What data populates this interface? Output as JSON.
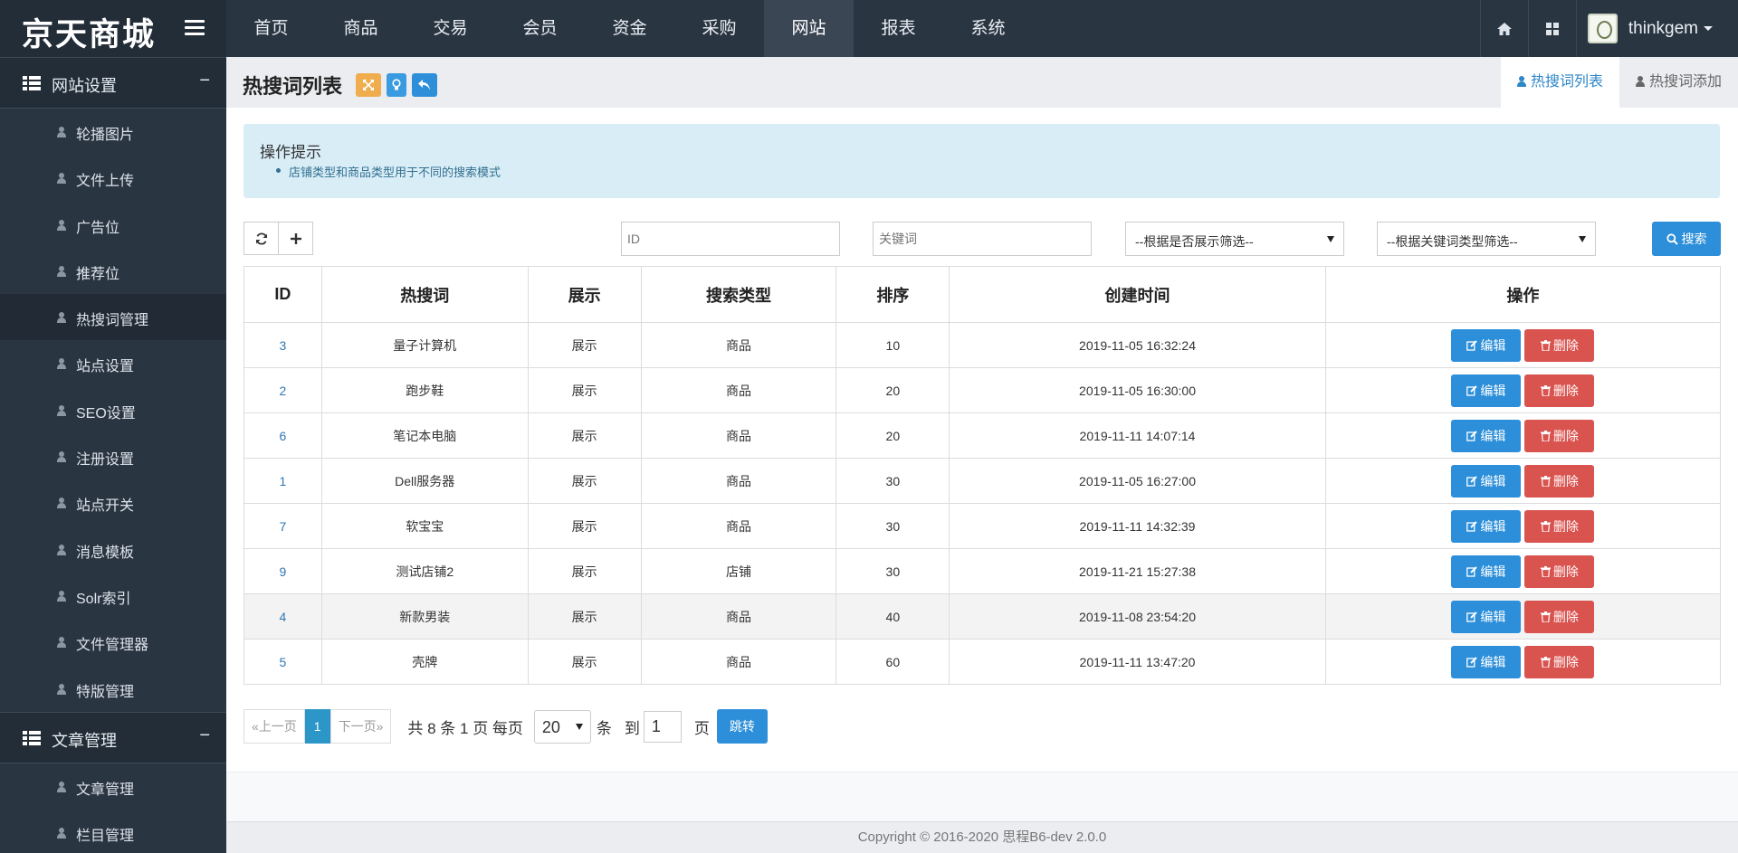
{
  "brand": {
    "logo": "京天商城"
  },
  "topnav": [
    "首页",
    "商品",
    "交易",
    "会员",
    "资金",
    "采购",
    "网站",
    "报表",
    "系统"
  ],
  "topnav_active": "网站",
  "user": {
    "name": "thinkgem"
  },
  "sidebar": {
    "sections": [
      {
        "title": "网站设置",
        "toggle": "−",
        "items": [
          "轮播图片",
          "文件上传",
          "广告位",
          "推荐位",
          "热搜词管理",
          "站点设置",
          "SEO设置",
          "注册设置",
          "站点开关",
          "消息模板",
          "Solr索引",
          "文件管理器",
          "特版管理"
        ]
      },
      {
        "title": "文章管理",
        "toggle": "−",
        "items": [
          "文章管理",
          "栏目管理"
        ]
      }
    ],
    "active_item": "热搜词管理"
  },
  "page": {
    "title": "热搜词列表",
    "tabs": [
      "热搜词列表",
      "热搜词添加"
    ],
    "tip_title": "操作提示",
    "tip_text": "店铺类型和商品类型用于不同的搜索模式"
  },
  "filters": {
    "id_placeholder": "ID",
    "keyword_placeholder": "关键词",
    "show_select": "--根据是否展示筛选--",
    "type_select": "--根据关键词类型筛选--",
    "search_label": "搜索"
  },
  "table": {
    "headers": [
      "ID",
      "热搜词",
      "展示",
      "搜索类型",
      "排序",
      "创建时间",
      "操作"
    ],
    "rows": [
      [
        "3",
        "量子计算机",
        "展示",
        "商品",
        "10",
        "2019-11-05 16:32:24"
      ],
      [
        "2",
        "跑步鞋",
        "展示",
        "商品",
        "20",
        "2019-11-05 16:30:00"
      ],
      [
        "6",
        "笔记本电脑",
        "展示",
        "商品",
        "20",
        "2019-11-11 14:07:14"
      ],
      [
        "1",
        "Dell服务器",
        "展示",
        "商品",
        "30",
        "2019-11-05 16:27:00"
      ],
      [
        "7",
        "软宝宝",
        "展示",
        "商品",
        "30",
        "2019-11-11 14:32:39"
      ],
      [
        "9",
        "测试店铺2",
        "展示",
        "店铺",
        "30",
        "2019-11-21 15:27:38"
      ],
      [
        "4",
        "新款男装",
        "展示",
        "商品",
        "40",
        "2019-11-08 23:54:20"
      ],
      [
        "5",
        "壳牌",
        "展示",
        "商品",
        "60",
        "2019-11-11 13:47:20"
      ]
    ],
    "edit_label": "编辑",
    "delete_label": "删除",
    "highlighted_row": "4"
  },
  "pager": {
    "prev": "«上一页",
    "current": "1",
    "next": "下一页»",
    "total_text": "共 8 条 1 页 每页",
    "page_size": "20",
    "unit": "条",
    "to": "到",
    "page_input": "1",
    "page_word": "页",
    "jump": "跳转"
  },
  "footer": "Copyright © 2016-2020  思程B6-dev  2.0.0",
  "colors": {
    "topbar": "#2a3542",
    "sidebar": "#2a3542",
    "primary": "#2d8fd9",
    "danger": "#d9534f",
    "tip_bg": "#d9edf7"
  }
}
